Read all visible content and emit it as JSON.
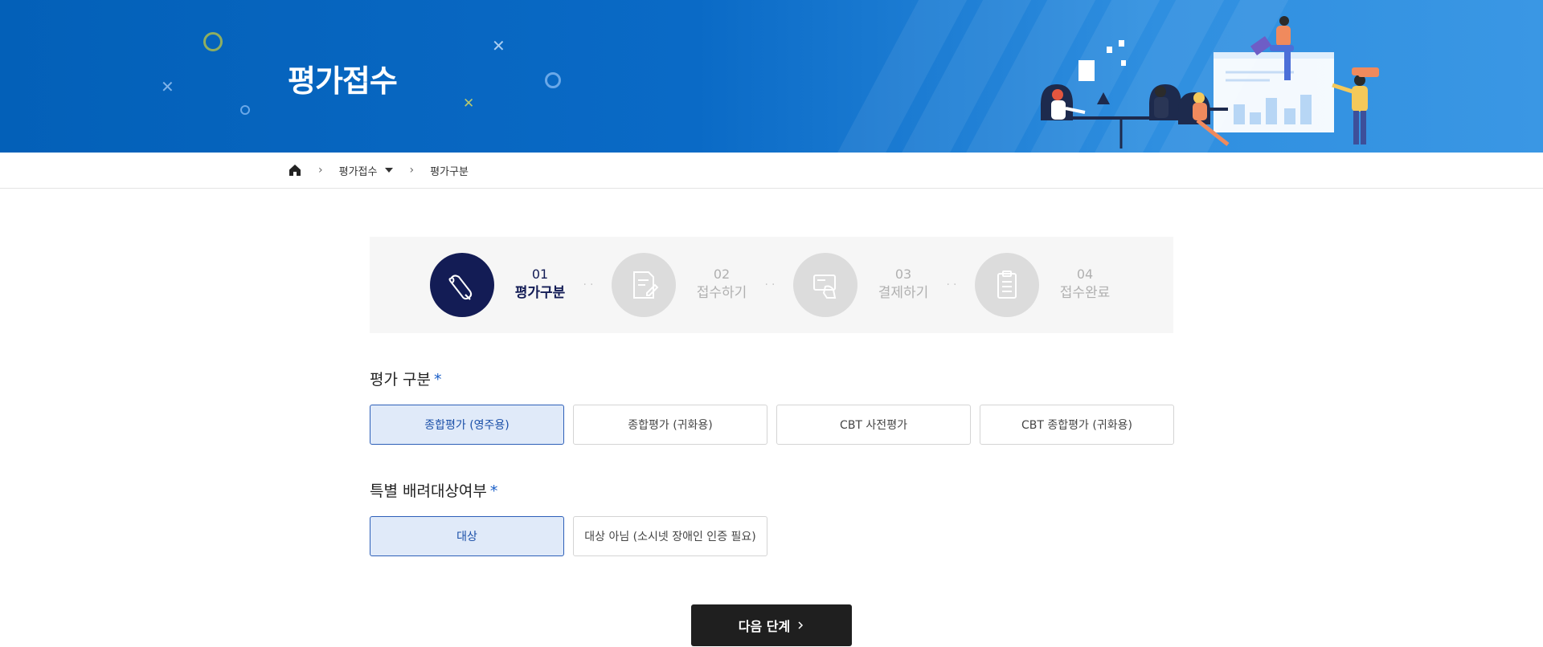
{
  "banner": {
    "title": "평가접수"
  },
  "breadcrumb": {
    "home_icon": "home-icon",
    "items": [
      "평가접수",
      "평가구분"
    ]
  },
  "stepper": {
    "steps": [
      {
        "num": "01",
        "label": "평가구분",
        "icon": "rolled-paper-icon",
        "active": true
      },
      {
        "num": "02",
        "label": "접수하기",
        "icon": "document-edit-icon",
        "active": false
      },
      {
        "num": "03",
        "label": "결제하기",
        "icon": "card-payment-icon",
        "active": false
      },
      {
        "num": "04",
        "label": "접수완료",
        "icon": "clipboard-icon",
        "active": false
      }
    ]
  },
  "eval_type": {
    "title": "평가 구분",
    "required_mark": "*",
    "options": [
      {
        "label": "종합평가 (영주용)",
        "selected": true
      },
      {
        "label": "종합평가 (귀화용)",
        "selected": false
      },
      {
        "label": "CBT 사전평가",
        "selected": false
      },
      {
        "label": "CBT 종합평가 (귀화용)",
        "selected": false
      }
    ]
  },
  "special_care": {
    "title": "특별 배려대상여부",
    "required_mark": "*",
    "options": [
      {
        "label": "대상",
        "selected": true
      },
      {
        "label": "대상 아님 (소시넷 장애인 인증 필요)",
        "selected": false
      }
    ]
  },
  "actions": {
    "next_label": "다음 단계",
    "next_icon": "chevron-right-icon"
  },
  "colors": {
    "banner_blue": "#0a6ac6",
    "active_step": "#131c55",
    "selected_bg": "#e0eaf9",
    "selected_border": "#2d5fb8",
    "required": "#1a5fc8",
    "button_dark": "#1f1f1f"
  }
}
